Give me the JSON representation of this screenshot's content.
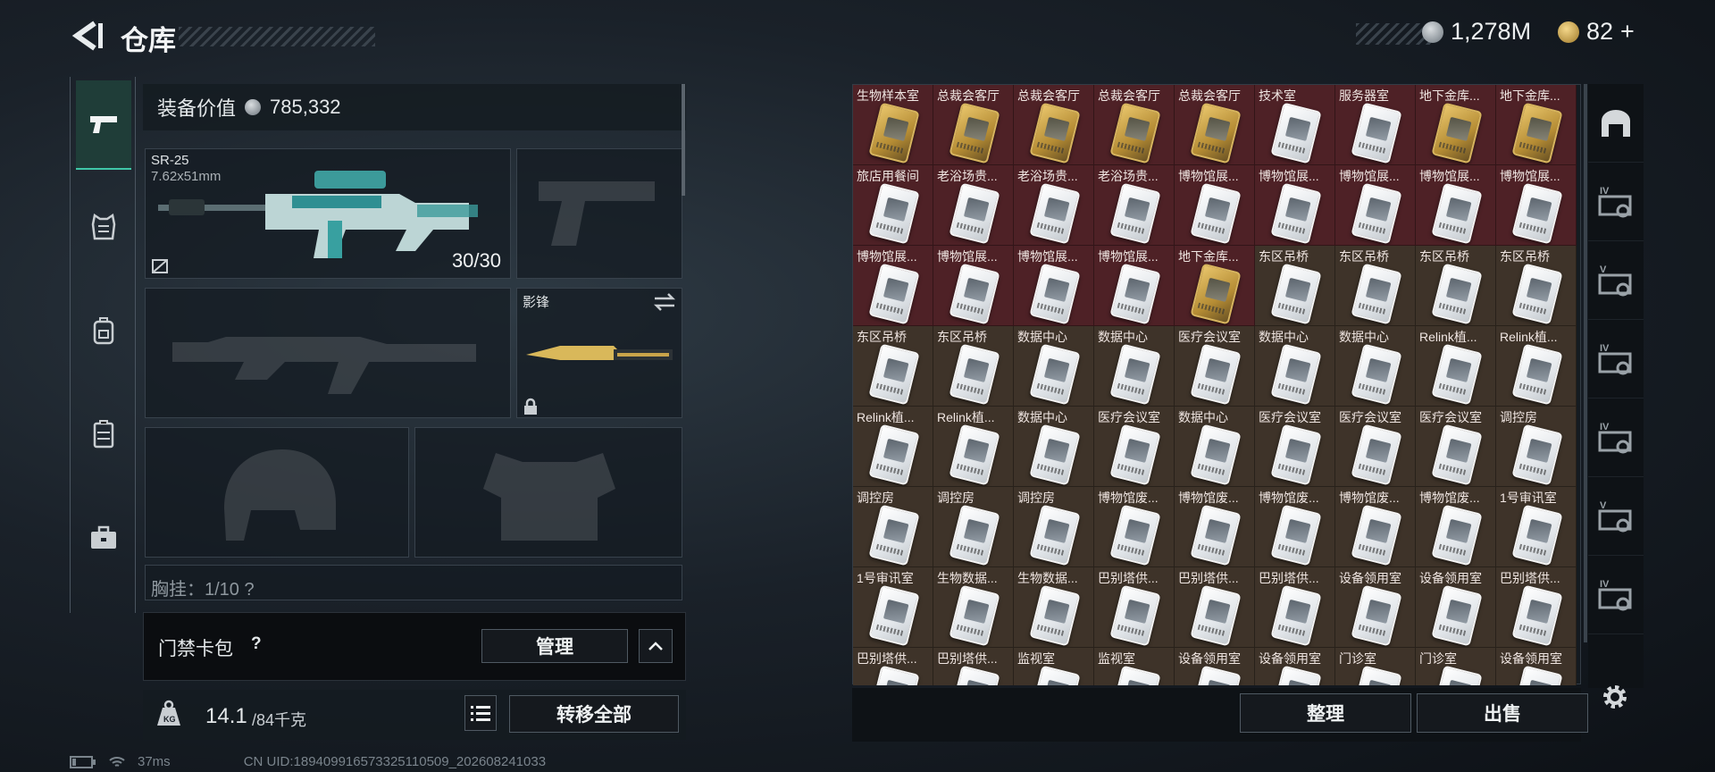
{
  "header": {
    "title": "仓库",
    "currency_silver": "1,278M",
    "currency_gold": "82",
    "currency_gold_suffix": "+"
  },
  "nav": {
    "tabs": [
      {
        "icon": "pistol-icon",
        "active": true
      },
      {
        "icon": "vest-icon",
        "active": false
      },
      {
        "icon": "backpack-icon",
        "active": false
      },
      {
        "icon": "rig-icon",
        "active": false
      },
      {
        "icon": "case-icon",
        "active": false
      }
    ]
  },
  "equipment": {
    "value_label": "装备价值",
    "value": "785,332",
    "primary_name": "SR-25",
    "primary_caliber": "7.62x51mm",
    "primary_ammo": "30/30",
    "melee_name": "影锋",
    "rig_label": "胸挂：1/10",
    "rig_help": "?"
  },
  "cardpack": {
    "label": "门禁卡包",
    "help": "?",
    "manage_label": "管理"
  },
  "weight": {
    "current": "14.1",
    "max": "/84千克",
    "transfer_all_label": "转移全部"
  },
  "storage": {
    "cells": [
      {
        "label": "生物样本室",
        "bg": "red",
        "card": "gold"
      },
      {
        "label": "总裁会客厅",
        "bg": "red",
        "card": "gold"
      },
      {
        "label": "总裁会客厅",
        "bg": "red",
        "card": "gold"
      },
      {
        "label": "总裁会客厅",
        "bg": "red",
        "card": "gold"
      },
      {
        "label": "总裁会客厅",
        "bg": "red",
        "card": "gold"
      },
      {
        "label": "技术室",
        "bg": "red",
        "card": "white"
      },
      {
        "label": "服务器室",
        "bg": "red",
        "card": "white"
      },
      {
        "label": "地下金库...",
        "bg": "red",
        "card": "gold"
      },
      {
        "label": "地下金库...",
        "bg": "red",
        "card": "gold"
      },
      {
        "label": "旅店用餐间",
        "bg": "red",
        "card": "white"
      },
      {
        "label": "老浴场贵...",
        "bg": "red",
        "card": "white"
      },
      {
        "label": "老浴场贵...",
        "bg": "red",
        "card": "white"
      },
      {
        "label": "老浴场贵...",
        "bg": "red",
        "card": "white"
      },
      {
        "label": "博物馆展...",
        "bg": "red",
        "card": "white"
      },
      {
        "label": "博物馆展...",
        "bg": "red",
        "card": "white"
      },
      {
        "label": "博物馆展...",
        "bg": "red",
        "card": "white"
      },
      {
        "label": "博物馆展...",
        "bg": "red",
        "card": "white"
      },
      {
        "label": "博物馆展...",
        "bg": "red",
        "card": "white"
      },
      {
        "label": "博物馆展...",
        "bg": "red",
        "card": "white"
      },
      {
        "label": "博物馆展...",
        "bg": "red",
        "card": "white"
      },
      {
        "label": "博物馆展...",
        "bg": "red",
        "card": "white"
      },
      {
        "label": "博物馆展...",
        "bg": "red",
        "card": "white"
      },
      {
        "label": "地下金库...",
        "bg": "red",
        "card": "gold"
      },
      {
        "label": "东区吊桥",
        "bg": "brn",
        "card": "white"
      },
      {
        "label": "东区吊桥",
        "bg": "brn",
        "card": "white"
      },
      {
        "label": "东区吊桥",
        "bg": "brn",
        "card": "white"
      },
      {
        "label": "东区吊桥",
        "bg": "brn",
        "card": "white"
      },
      {
        "label": "东区吊桥",
        "bg": "brn",
        "card": "white"
      },
      {
        "label": "东区吊桥",
        "bg": "brn",
        "card": "white"
      },
      {
        "label": "数据中心",
        "bg": "brn",
        "card": "white"
      },
      {
        "label": "数据中心",
        "bg": "brn",
        "card": "white"
      },
      {
        "label": "医疗会议室",
        "bg": "brn",
        "card": "white"
      },
      {
        "label": "数据中心",
        "bg": "brn",
        "card": "white"
      },
      {
        "label": "数据中心",
        "bg": "brn",
        "card": "white"
      },
      {
        "label": "Relink植...",
        "bg": "brn",
        "card": "white"
      },
      {
        "label": "Relink植...",
        "bg": "brn",
        "card": "white"
      },
      {
        "label": "Relink植...",
        "bg": "brn",
        "card": "white"
      },
      {
        "label": "Relink植...",
        "bg": "brn",
        "card": "white"
      },
      {
        "label": "数据中心",
        "bg": "brn",
        "card": "white"
      },
      {
        "label": "医疗会议室",
        "bg": "brn",
        "card": "white"
      },
      {
        "label": "数据中心",
        "bg": "brn",
        "card": "white"
      },
      {
        "label": "医疗会议室",
        "bg": "brn",
        "card": "white"
      },
      {
        "label": "医疗会议室",
        "bg": "brn",
        "card": "white"
      },
      {
        "label": "医疗会议室",
        "bg": "brn",
        "card": "white"
      },
      {
        "label": "调控房",
        "bg": "brn",
        "card": "white"
      },
      {
        "label": "调控房",
        "bg": "brn",
        "card": "white"
      },
      {
        "label": "调控房",
        "bg": "brn",
        "card": "white"
      },
      {
        "label": "调控房",
        "bg": "brn",
        "card": "white"
      },
      {
        "label": "博物馆废...",
        "bg": "brn",
        "card": "white"
      },
      {
        "label": "博物馆废...",
        "bg": "brn",
        "card": "white"
      },
      {
        "label": "博物馆废...",
        "bg": "brn",
        "card": "white"
      },
      {
        "label": "博物馆废...",
        "bg": "brn",
        "card": "white"
      },
      {
        "label": "博物馆废...",
        "bg": "brn",
        "card": "white"
      },
      {
        "label": "1号审讯室",
        "bg": "brn",
        "card": "white"
      },
      {
        "label": "1号审讯室",
        "bg": "brn",
        "card": "white"
      },
      {
        "label": "生物数据...",
        "bg": "brn",
        "card": "white"
      },
      {
        "label": "生物数据...",
        "bg": "brn",
        "card": "white"
      },
      {
        "label": "巴别塔供...",
        "bg": "brn",
        "card": "white"
      },
      {
        "label": "巴别塔供...",
        "bg": "brn",
        "card": "white"
      },
      {
        "label": "巴别塔供...",
        "bg": "brn",
        "card": "white"
      },
      {
        "label": "设备领用室",
        "bg": "brn",
        "card": "white"
      },
      {
        "label": "设备领用室",
        "bg": "brn",
        "card": "white"
      },
      {
        "label": "巴别塔供...",
        "bg": "brn",
        "card": "white"
      },
      {
        "label": "巴别塔供...",
        "bg": "brn",
        "card": "white"
      },
      {
        "label": "巴别塔供...",
        "bg": "brn",
        "card": "white"
      },
      {
        "label": "监视室",
        "bg": "brn",
        "card": "white"
      },
      {
        "label": "监视室",
        "bg": "brn",
        "card": "white"
      },
      {
        "label": "设备领用室",
        "bg": "brn",
        "card": "white"
      },
      {
        "label": "设备领用室",
        "bg": "brn",
        "card": "white"
      },
      {
        "label": "门诊室",
        "bg": "brn",
        "card": "white"
      },
      {
        "label": "门诊室",
        "bg": "brn",
        "card": "white"
      },
      {
        "label": "设备领用室",
        "bg": "brn",
        "card": "white"
      }
    ],
    "sort_label": "整理",
    "sell_label": "出售"
  },
  "filters": [
    {
      "icon": "arch-icon"
    },
    {
      "icon": "iv-case-icon",
      "tier": "IV"
    },
    {
      "icon": "v-case-icon",
      "tier": "V"
    },
    {
      "icon": "iv-case-icon",
      "tier": "IV"
    },
    {
      "icon": "iv-case-icon",
      "tier": "IV"
    },
    {
      "icon": "v-case-icon",
      "tier": "V"
    },
    {
      "icon": "iv-case-icon",
      "tier": "IV"
    }
  ],
  "status": {
    "ping": "37ms",
    "uid": "CN UID:18940991657332511050​9_202608241033"
  }
}
